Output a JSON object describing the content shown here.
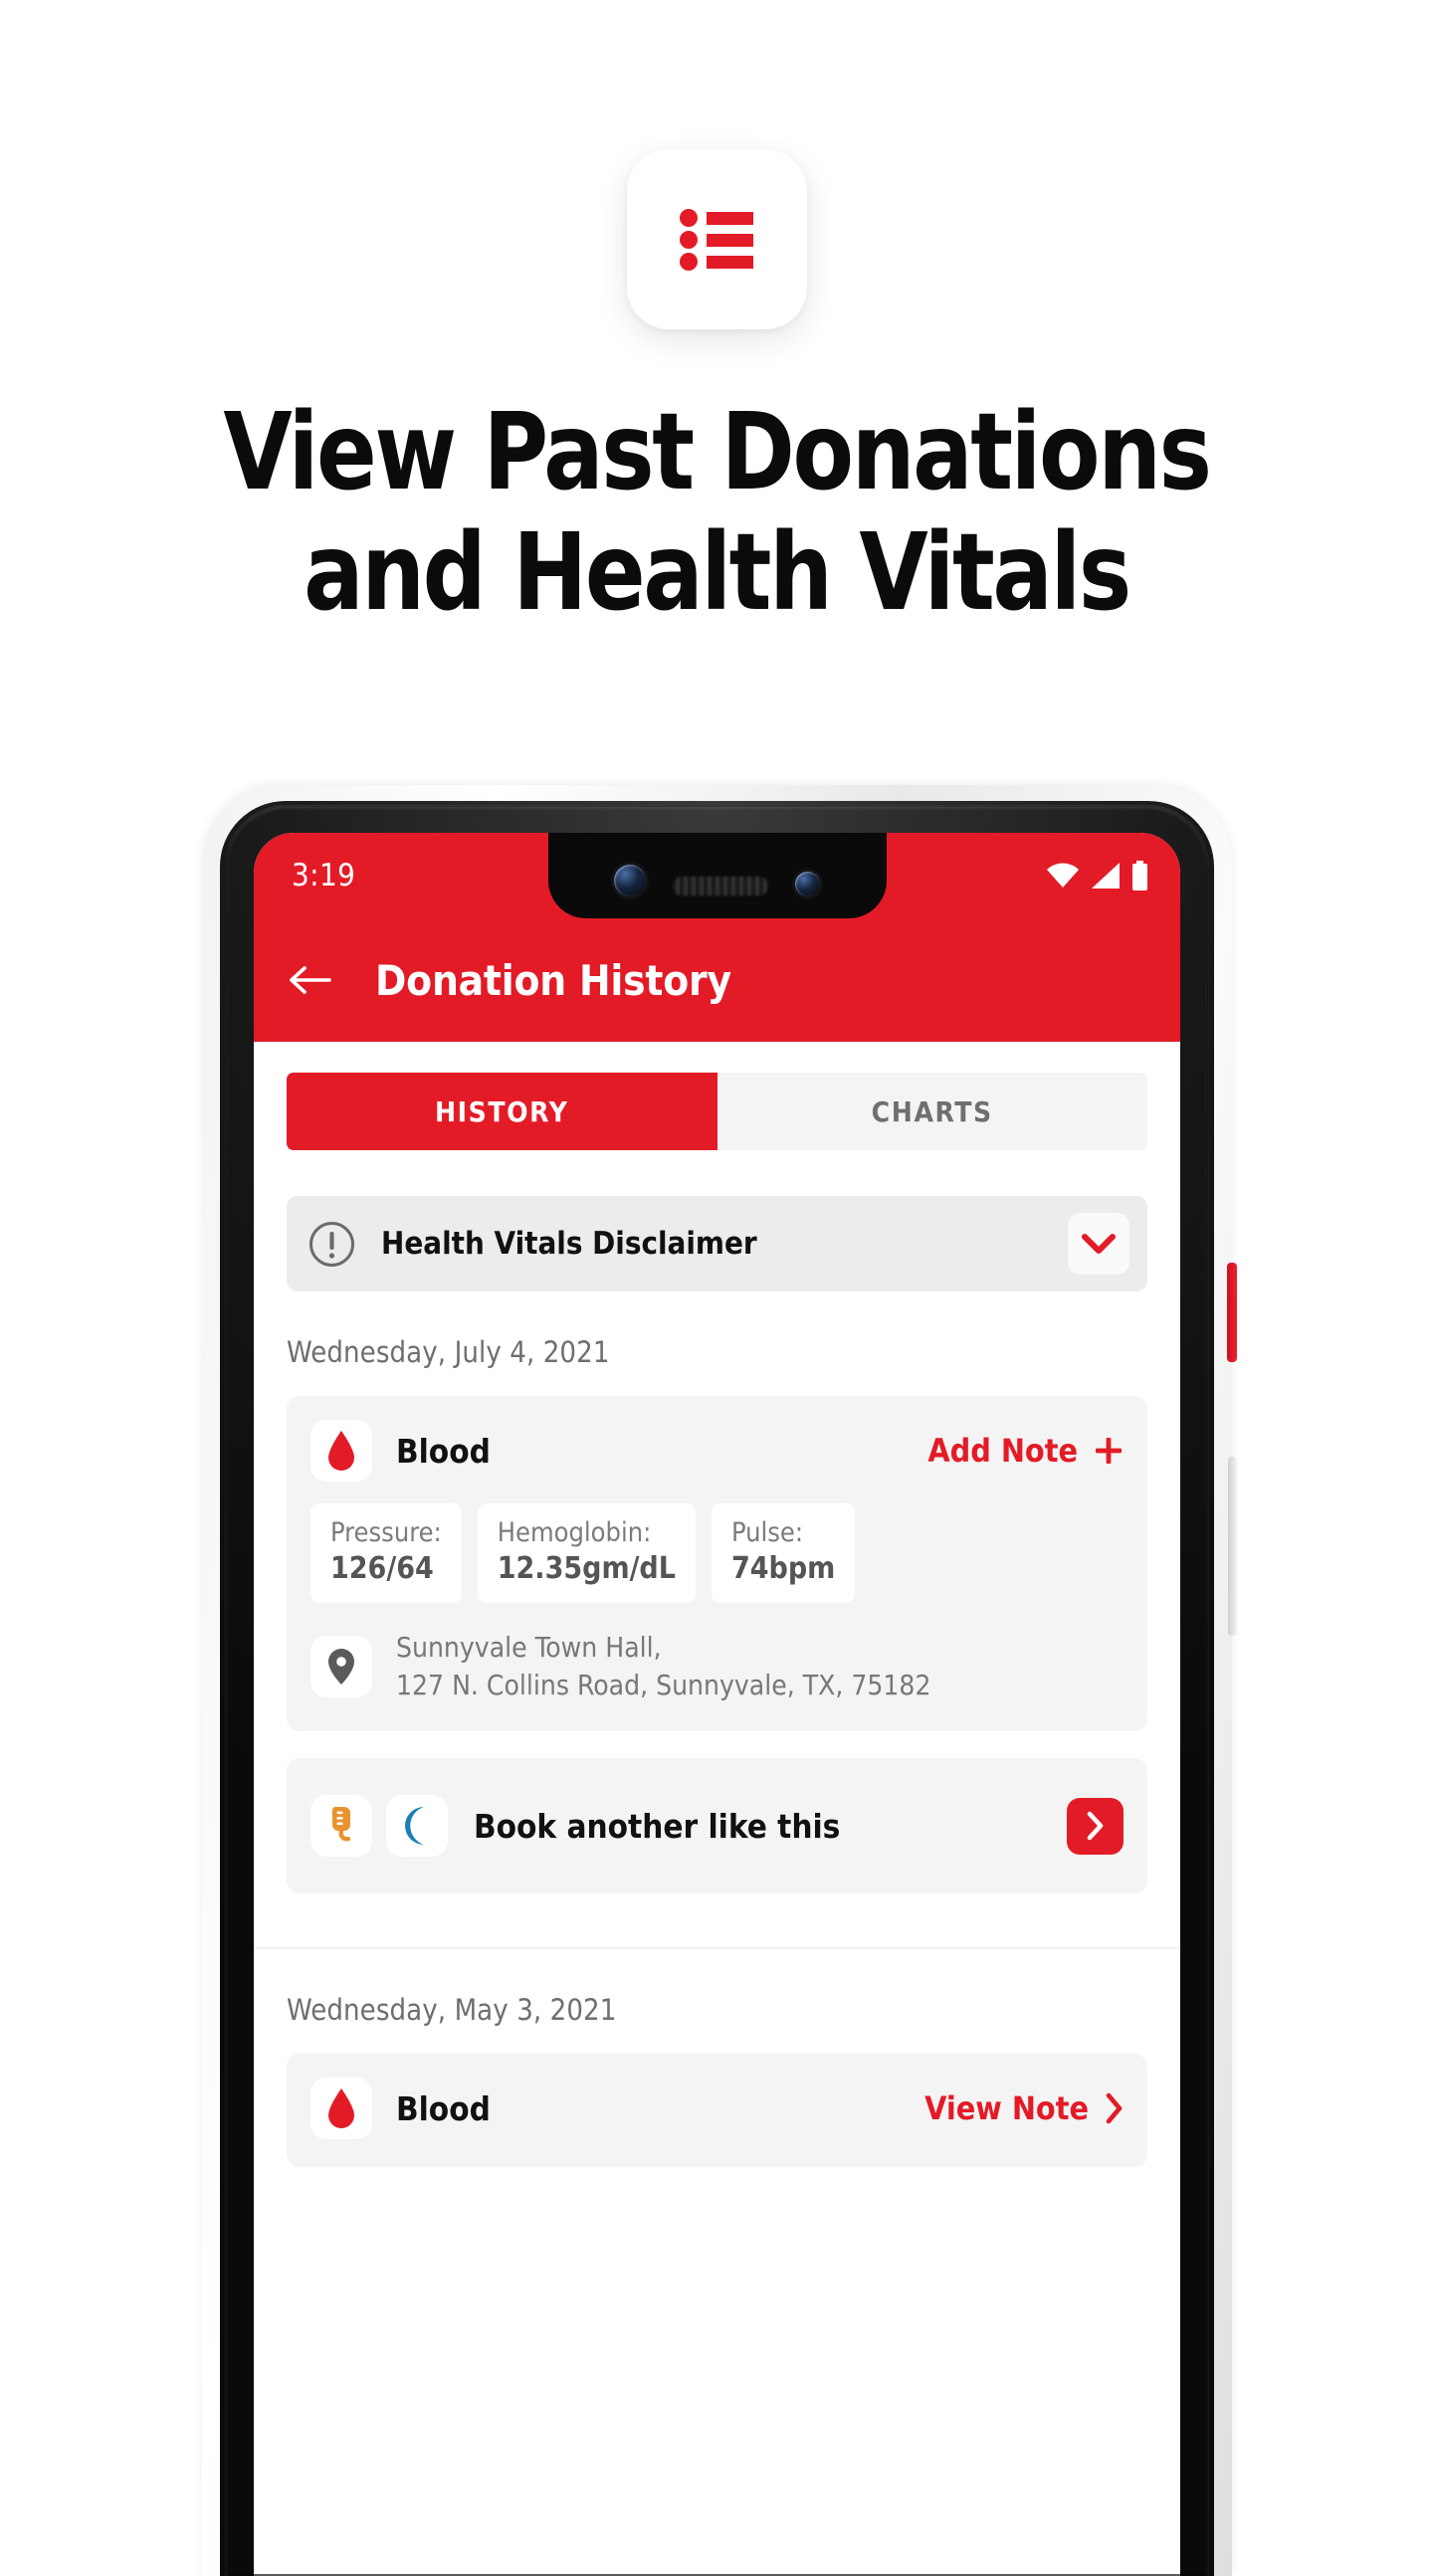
{
  "promo": {
    "app_icon": "list-icon",
    "headline_line1": "View Past Donations",
    "headline_line2": "and Health Vitals",
    "brand_red": "#e31b27"
  },
  "phone": {
    "status_bar": {
      "time": "3:19",
      "icons": [
        "wifi-icon",
        "cellular-signal-icon",
        "battery-icon"
      ]
    },
    "side_buttons": [
      "power-button",
      "volume-rocker"
    ]
  },
  "app_bar": {
    "back_icon": "back-arrow-icon",
    "title": "Donation History"
  },
  "tabs": [
    {
      "label": "HISTORY",
      "active": true
    },
    {
      "label": "CHARTS",
      "active": false
    }
  ],
  "disclaimer": {
    "icon": "exclamation-circle-icon",
    "label": "Health Vitals Disclaimer",
    "expand_icon": "chevron-down-icon",
    "expanded": false
  },
  "entries": [
    {
      "date": "Wednesday, July 4, 2021",
      "type": "Blood",
      "type_icon": "blood-drop-icon",
      "note_action": "Add Note",
      "note_action_icon": "plus-icon",
      "vitals": [
        {
          "label": "Pressure:",
          "value": "126/64"
        },
        {
          "label": "Hemoglobin:",
          "value": "12.35gm/dL"
        },
        {
          "label": "Pulse:",
          "value": "74bpm"
        }
      ],
      "location_icon": "map-pin-icon",
      "location_line1": "Sunnyvale Town Hall,",
      "location_line2": "127 N. Collins Road, Sunnyvale, TX, 75182",
      "book_row": {
        "icons": [
          "plasma-bag-icon",
          "crescent-moon-icon"
        ],
        "label": "Book another like this",
        "go_icon": "chevron-right-icon"
      }
    },
    {
      "date": "Wednesday, May 3, 2021",
      "type": "Blood",
      "type_icon": "blood-drop-icon",
      "note_action": "View Note",
      "note_action_icon": "chevron-right-icon"
    }
  ]
}
